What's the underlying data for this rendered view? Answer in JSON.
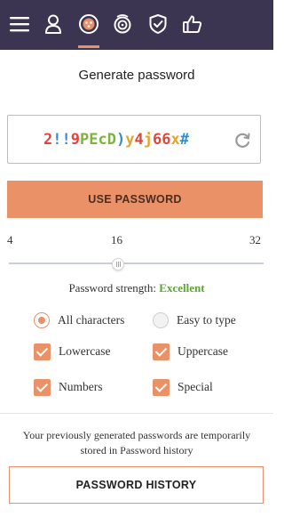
{
  "nav": {
    "items": [
      {
        "icon": "hamburger-menu-icon",
        "active": false
      },
      {
        "icon": "user-icon",
        "active": false
      },
      {
        "icon": "password-generator-icon",
        "active": true
      },
      {
        "icon": "fingerprint-scan-icon",
        "active": false
      },
      {
        "icon": "shield-icon",
        "active": false
      },
      {
        "icon": "thumbs-up-icon",
        "active": false
      }
    ],
    "background": "#3c3552",
    "accent": "#e8906a"
  },
  "title": "Generate password",
  "password": {
    "chars": [
      {
        "c": "2",
        "color": "#e0463a"
      },
      {
        "c": "!",
        "color": "#2f8fd6"
      },
      {
        "c": "!",
        "color": "#2f8fd6"
      },
      {
        "c": "9",
        "color": "#e0463a"
      },
      {
        "c": "P",
        "color": "#7ab53a"
      },
      {
        "c": "E",
        "color": "#7ab53a"
      },
      {
        "c": "c",
        "color": "#7ab53a"
      },
      {
        "c": "D",
        "color": "#7ab53a"
      },
      {
        "c": ")",
        "color": "#2f8fd6"
      },
      {
        "c": "y",
        "color": "#e3a52a"
      },
      {
        "c": "4",
        "color": "#e0463a"
      },
      {
        "c": "j",
        "color": "#e3a52a"
      },
      {
        "c": "6",
        "color": "#e0463a"
      },
      {
        "c": "6",
        "color": "#e0463a"
      },
      {
        "c": "x",
        "color": "#e3a52a"
      },
      {
        "c": "#",
        "color": "#2f8fd6"
      }
    ]
  },
  "use_button": "USE PASSWORD",
  "slider": {
    "min": "4",
    "value": "16",
    "max": "32",
    "value_fraction": 0.43
  },
  "strength": {
    "label": "Password strength:",
    "value": "Excellent",
    "color": "#5aa632"
  },
  "options": {
    "all_characters": {
      "label": "All characters",
      "selected": true
    },
    "easy_to_type": {
      "label": "Easy to type",
      "selected": false
    },
    "lowercase": {
      "label": "Lowercase",
      "checked": true
    },
    "uppercase": {
      "label": "Uppercase",
      "checked": true
    },
    "numbers": {
      "label": "Numbers",
      "checked": true
    },
    "special": {
      "label": "Special",
      "checked": true
    }
  },
  "history_note": "Your previously generated passwords are temporarily stored in Password history",
  "history_button": "PASSWORD HISTORY"
}
